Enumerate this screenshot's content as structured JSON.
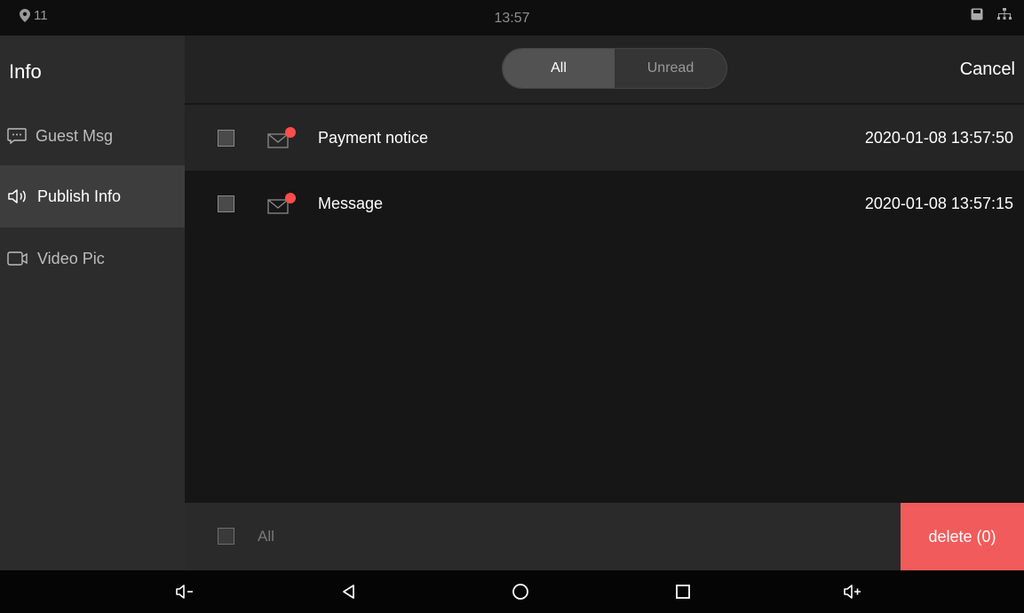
{
  "status_bar": {
    "location_count": "11",
    "time": "13:57",
    "icons": [
      "location-pin-icon",
      "sd-card-icon",
      "network-icon"
    ]
  },
  "sidebar": {
    "title": "Info",
    "items": [
      {
        "label": "Guest Msg",
        "icon": "chat-bubble-icon",
        "active": false
      },
      {
        "label": "Publish Info",
        "icon": "speaker-icon",
        "active": true
      },
      {
        "label": "Video Pic",
        "icon": "video-camera-icon",
        "active": false
      }
    ]
  },
  "header": {
    "segments": [
      {
        "label": "All",
        "selected": true
      },
      {
        "label": "Unread",
        "selected": false
      }
    ],
    "cancel_label": "Cancel"
  },
  "messages": [
    {
      "title": "Payment notice",
      "time": "2020-01-08 13:57:50",
      "unread": true,
      "checked": false
    },
    {
      "title": "Message",
      "time": "2020-01-08 13:57:15",
      "unread": true,
      "checked": false
    }
  ],
  "footer": {
    "select_all_label": "All",
    "delete_label": "delete (0)"
  },
  "nav_bar": {
    "icons": [
      "volume-down-icon",
      "back-icon",
      "home-icon",
      "recents-icon",
      "volume-up-icon"
    ]
  },
  "colors": {
    "accent_delete": "#f25b5b",
    "unread_dot": "#ff4d4d",
    "active_item_bg": "#3d3d3d"
  }
}
